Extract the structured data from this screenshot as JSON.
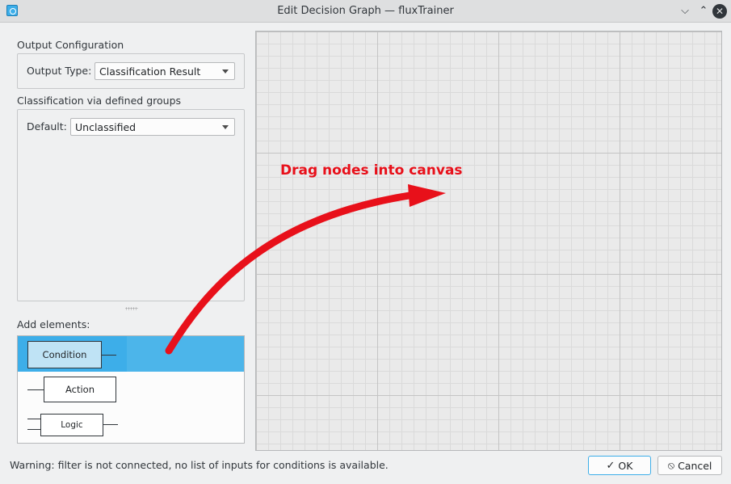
{
  "window": {
    "title": "Edit Decision Graph — fluxTrainer",
    "controls": [
      "chevron-down",
      "chevron-up",
      "close"
    ]
  },
  "output_config": {
    "section_title": "Output Configuration",
    "type_label": "Output Type:",
    "type_value": "Classification Result"
  },
  "classification": {
    "section_title": "Classification via defined groups",
    "default_label": "Default:",
    "default_value": "Unclassified"
  },
  "elements": {
    "section_title": "Add elements:",
    "items": [
      {
        "label": "Condition",
        "selected": true
      },
      {
        "label": "Action",
        "selected": false
      },
      {
        "label": "Logic",
        "selected": false
      }
    ]
  },
  "canvas": {
    "hint": "Drag nodes into canvas"
  },
  "colors": {
    "accent": "#3daee9",
    "hint_red": "#e8101a",
    "condition_fill": "#bfe3f5"
  },
  "footer": {
    "warning": "Warning: filter is not connected, no list of inputs for conditions is available.",
    "ok_label": "OK",
    "cancel_label": "Cancel"
  }
}
